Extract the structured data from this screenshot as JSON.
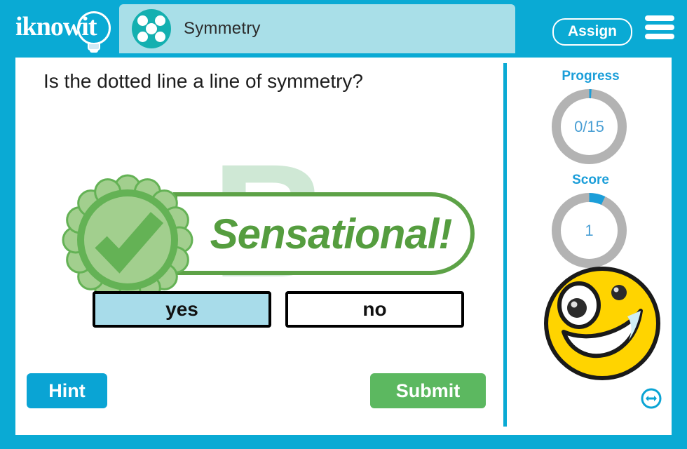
{
  "header": {
    "logo_text": "iknowit",
    "logo_icon": "lightbulb-icon",
    "tab_label": "Symmetry",
    "tab_icon": "five-dot-circle-icon",
    "assign_label": "Assign",
    "menu_icon": "hamburger-menu-icon"
  },
  "main": {
    "question": "Is the dotted line a line of symmetry?",
    "background_letter": "B",
    "feedback": {
      "message": "Sensational!",
      "badge_icon": "check-badge-icon",
      "correct": true
    },
    "answers": [
      {
        "label": "yes",
        "selected": true
      },
      {
        "label": "no",
        "selected": false
      }
    ],
    "hint_label": "Hint",
    "submit_label": "Submit"
  },
  "sidebar": {
    "progress_label": "Progress",
    "progress_value": "0/15",
    "progress_pct": 1,
    "score_label": "Score",
    "score_value": "1",
    "score_pct": 7,
    "mascot_icon": "smiley-face-icon",
    "resize_icon": "resize-horizontal-icon"
  },
  "colors": {
    "frame_blue": "#0aaad4",
    "tab_blue": "#a9dfe8",
    "tab_icon_teal": "#14b0b0",
    "accent_blue": "#1b9ed9",
    "green": "#5cb860",
    "banner_green": "#5da247",
    "faint_green": "#cfe8d5",
    "selected_answer": "#a8dcea",
    "ring_grey": "#b3b3b3",
    "smiley_yellow": "#ffd93b"
  }
}
